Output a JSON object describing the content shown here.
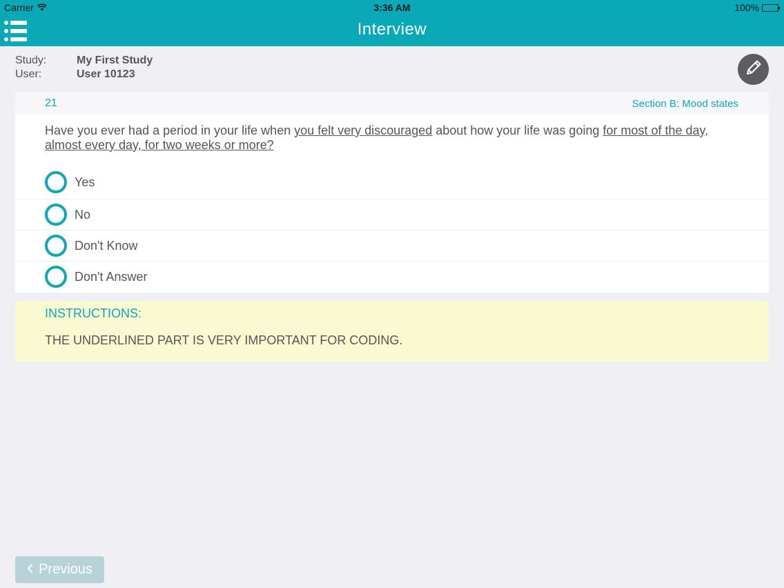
{
  "status_bar": {
    "carrier": "Carrier",
    "time": "3:36 AM",
    "battery": "100%"
  },
  "nav": {
    "title": "Interview",
    "menu_icon": "list-icon"
  },
  "header": {
    "study_label": "Study:",
    "study_value": "My First Study",
    "user_label": "User:",
    "user_value": "User 10123",
    "edit_icon": "pencil-icon"
  },
  "question": {
    "number": "21",
    "section": "Section B: Mood states",
    "text_parts": [
      "Have you ever had a period in your life when ",
      "you felt very discouraged",
      " about how your life was going ",
      "for most of the day, almost every day, for two weeks or more?"
    ],
    "options": [
      "Yes",
      "No",
      "Don't Know",
      "Don't Answer"
    ],
    "selected_option": null
  },
  "instructions": {
    "heading": "INSTRUCTIONS:",
    "text": "THE UNDERLINED PART IS VERY IMPORTANT FOR CODING."
  },
  "footer": {
    "previous_label": "Previous",
    "previous_enabled": false
  },
  "colors": {
    "accent": "#0aa9b7",
    "background": "#efeff4",
    "instructions_bg": "#fafad2",
    "edit_button": "#5d5d5f",
    "previous_button": "#b6d4d8"
  }
}
